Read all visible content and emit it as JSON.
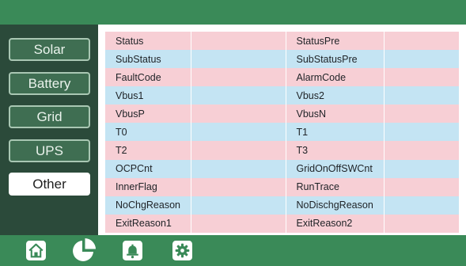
{
  "sidebar": {
    "items": [
      {
        "label": "Solar",
        "active": false
      },
      {
        "label": "Battery",
        "active": false
      },
      {
        "label": "Grid",
        "active": false
      },
      {
        "label": "UPS",
        "active": false
      },
      {
        "label": "Other",
        "active": true
      }
    ]
  },
  "table": {
    "rows": [
      [
        "Status",
        "",
        "StatusPre",
        ""
      ],
      [
        "SubStatus",
        "",
        "SubStatusPre",
        ""
      ],
      [
        "FaultCode",
        "",
        "AlarmCode",
        ""
      ],
      [
        "Vbus1",
        "",
        "Vbus2",
        ""
      ],
      [
        "VbusP",
        "",
        "VbusN",
        ""
      ],
      [
        "T0",
        "",
        "T1",
        ""
      ],
      [
        "T2",
        "",
        "T3",
        ""
      ],
      [
        "OCPCnt",
        "",
        "GridOnOffSWCnt",
        ""
      ],
      [
        "InnerFlag",
        "",
        "RunTrace",
        ""
      ],
      [
        "NoChgReason",
        "",
        "NoDischgReason",
        ""
      ],
      [
        "ExitReason1",
        "",
        "ExitReason2",
        ""
      ]
    ]
  },
  "bottom_nav": {
    "items": [
      {
        "icon": "home-icon"
      },
      {
        "icon": "pie-chart-icon",
        "active": true
      },
      {
        "icon": "bell-icon"
      },
      {
        "icon": "gear-icon"
      }
    ]
  },
  "colors": {
    "header": "#3a8a58",
    "sidebar": "#2b4a3a",
    "row_pink": "#f7cfd5",
    "row_blue": "#c4e4f3"
  }
}
